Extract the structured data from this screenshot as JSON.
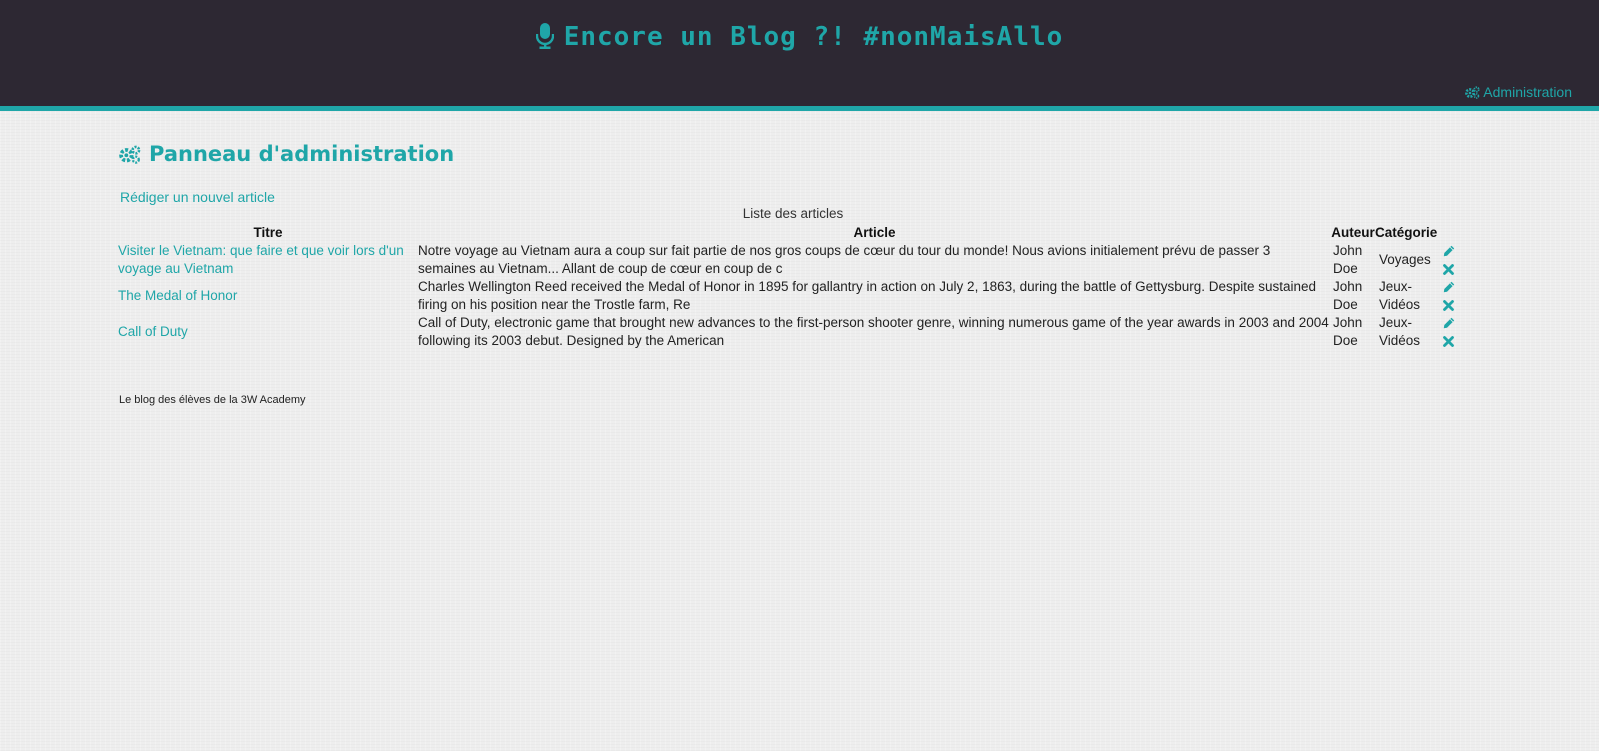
{
  "header": {
    "site_title": "Encore un Blog ?! #nonMaisAllo",
    "site_icon": "microphone-icon",
    "admin_link": "Administration",
    "admin_icon": "gears-icon",
    "accent_color": "#1fa6a8",
    "bar_color": "#2d2833"
  },
  "main": {
    "panel_title": "Panneau d'administration",
    "new_article_link": "Rédiger un nouvel article",
    "table": {
      "caption": "Liste des articles",
      "headers": {
        "title": "Titre",
        "article": "Article",
        "author": "Auteur",
        "category": "Catégorie"
      },
      "rows": [
        {
          "title": "Visiter le Vietnam: que faire et que voir lors d'un voyage au Vietnam",
          "article": "Notre voyage au Vietnam aura a coup sur fait partie de nos gros coups de cœur du tour du monde! Nous avions initialement prévu de passer 3 semaines au Vietnam... Allant de coup de cœur en coup de c",
          "author": "John Doe",
          "category": "Voyages"
        },
        {
          "title": "The Medal of Honor",
          "article": "Charles Wellington Reed received the Medal of Honor in 1895 for gallantry in action on July 2, 1863, during the battle of Gettysburg. Despite sustained firing on his position near the Trostle farm, Re",
          "author": "John Doe",
          "category": "Jeux-Vidéos"
        },
        {
          "title": "Call of Duty",
          "article": "Call of Duty, electronic game that brought new advances to the first-person shooter genre, winning numerous game of the year awards in 2003 and 2004 following its 2003 debut. Designed by the American",
          "author": "John Doe",
          "category": "Jeux-Vidéos"
        }
      ],
      "row_actions": [
        "pencil-icon",
        "close-icon"
      ]
    }
  },
  "footer": {
    "text": "Le blog des élèves de la 3W Academy"
  }
}
